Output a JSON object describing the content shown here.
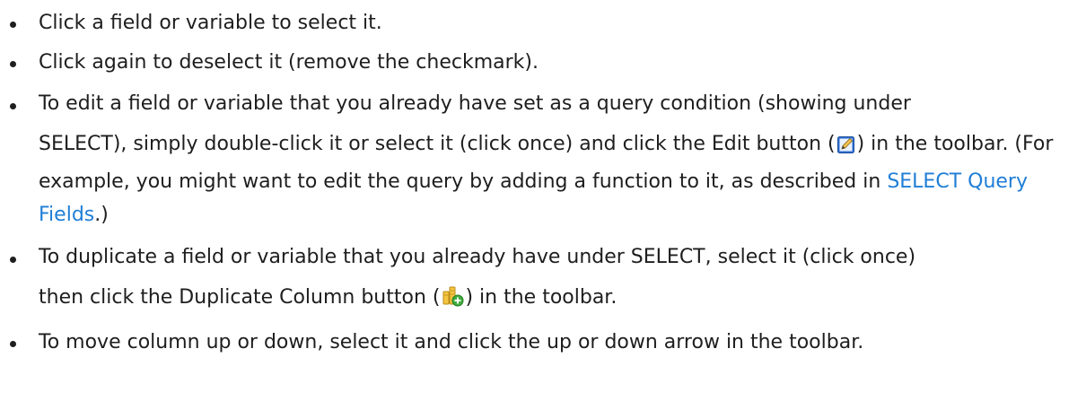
{
  "bullets": [
    {
      "text": "Click a field or variable to select it."
    },
    {
      "text": "Click again to deselect it (remove the checkmark)."
    },
    {
      "part1": "To edit a field or variable that you already have set as a query condition (showing under",
      "part2": "SELECT), simply double-click it or select it (click once) and click the Edit button (",
      "part3": ") in the toolbar. (For example, you might want to edit the query by adding a function to it, as described in ",
      "link": "SELECT Query Fields",
      "part4": ".)"
    },
    {
      "part1": "To duplicate a field or variable that you already have under SELECT, select it (click once)",
      "part2": "then click the Duplicate Column button (",
      "part3": ") in the toolbar."
    },
    {
      "text": "To move column up or down, select it and click the up or down arrow in the toolbar."
    }
  ],
  "icons": {
    "edit": "edit-icon",
    "duplicate": "duplicate-column-icon"
  },
  "colors": {
    "text": "#1e1e1e",
    "link": "#1f7ed6"
  }
}
